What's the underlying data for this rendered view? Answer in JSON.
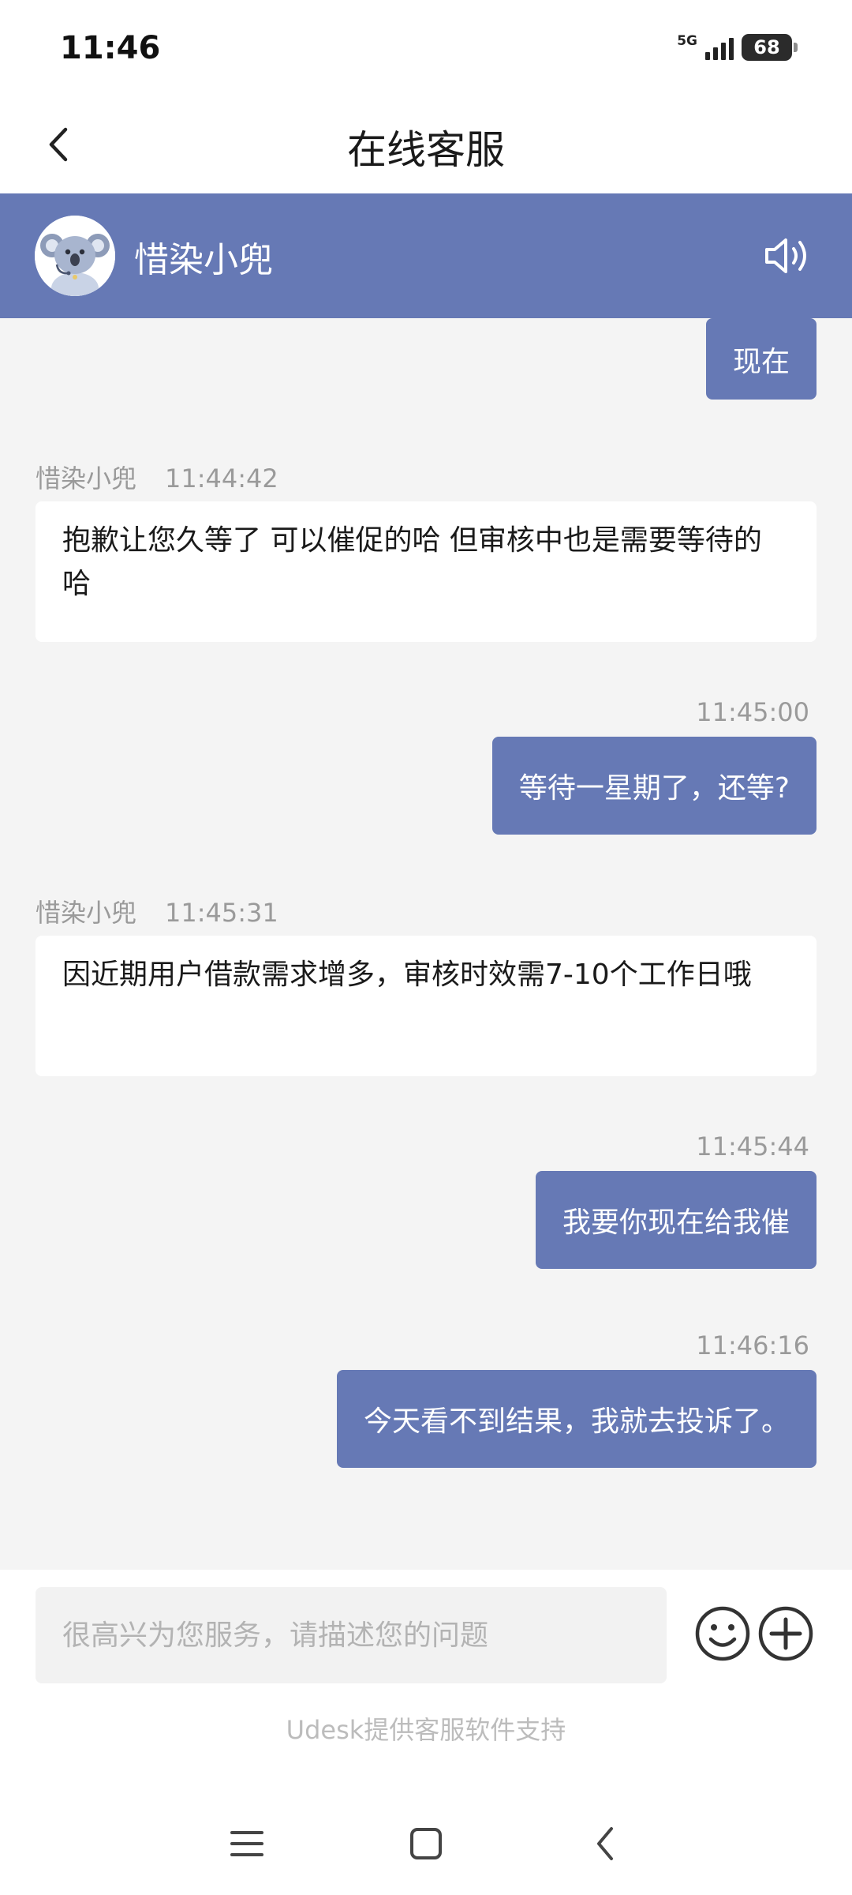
{
  "status_bar": {
    "time": "11:46",
    "network": "5G",
    "battery": "68"
  },
  "nav": {
    "title": "在线客服",
    "back_icon": "chevron-left-icon"
  },
  "agent": {
    "name": "惜染小兜",
    "avatar_icon": "koala-avatar-icon",
    "sound_icon": "speaker-icon"
  },
  "messages": [
    {
      "from": "user",
      "text": "现在"
    },
    {
      "from": "agent",
      "sender": "惜染小兜",
      "time": "11:44:42",
      "text": "抱歉让您久等了 可以催促的哈 但审核中也是需要等待的哈"
    },
    {
      "from": "user",
      "time": "11:45:00",
      "text": "等待一星期了，还等?"
    },
    {
      "from": "agent",
      "sender": "惜染小兜",
      "time": "11:45:31",
      "text": "因近期用户借款需求增多，审核时效需7-10个工作日哦"
    },
    {
      "from": "user",
      "time": "11:45:44",
      "text": "我要你现在给我催"
    },
    {
      "from": "user",
      "time": "11:46:16",
      "text": "今天看不到结果，我就去投诉了。"
    }
  ],
  "input": {
    "placeholder": "很高兴为您服务，请描述您的问题",
    "value": ""
  },
  "footer": {
    "powered_by": "Udesk提供客服软件支持"
  },
  "colors": {
    "accent": "#6679b5",
    "chat_background": "#f4f4f4"
  }
}
